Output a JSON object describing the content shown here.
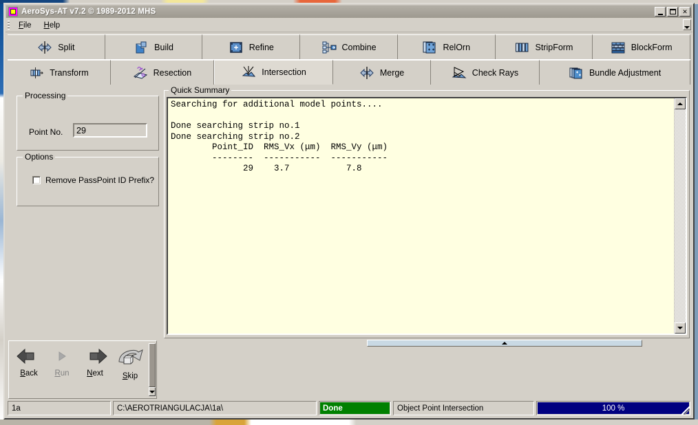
{
  "window": {
    "title": "AeroSys-AT  v7.2 © 1989-2012 MHS",
    "icon": "app-icon",
    "buttons": {
      "minimize": "_",
      "maximize": "□",
      "close": "✕"
    }
  },
  "menu": {
    "items": [
      {
        "label": "File",
        "accel": "F"
      },
      {
        "label": "Help",
        "accel": "H"
      }
    ],
    "overflow": "chevron-down-icon"
  },
  "toolbar": {
    "row1": [
      {
        "label": "Split",
        "icon": "split-icon",
        "selected": false
      },
      {
        "label": "Build",
        "icon": "build-icon",
        "selected": false
      },
      {
        "label": "Refine",
        "icon": "refine-icon",
        "selected": false
      },
      {
        "label": "Combine",
        "icon": "combine-icon",
        "selected": false
      },
      {
        "label": "RelOrn",
        "icon": "relorn-icon",
        "selected": false
      },
      {
        "label": "StripForm",
        "icon": "stripform-icon",
        "selected": false
      },
      {
        "label": "BlockForm",
        "icon": "blockform-icon",
        "selected": false
      }
    ],
    "row2": [
      {
        "label": "Transform",
        "icon": "transform-icon",
        "selected": false
      },
      {
        "label": "Resection",
        "icon": "resection-icon",
        "selected": false
      },
      {
        "label": "Intersection",
        "icon": "intersection-icon",
        "selected": true
      },
      {
        "label": "Merge",
        "icon": "merge-icon",
        "selected": false
      },
      {
        "label": "Check Rays",
        "icon": "check-rays-icon",
        "selected": false
      },
      {
        "label": "Bundle Adjustment",
        "icon": "bundle-adjustment-icon",
        "selected": false
      }
    ]
  },
  "processing": {
    "group_title": "Processing",
    "point_no_label": "Point  No.",
    "point_no_value": "29",
    "point_no_placeholder": ""
  },
  "options": {
    "group_title": "Options",
    "remove_prefix_label": "Remove PassPoint ID Prefix?",
    "remove_prefix_checked": false
  },
  "summary": {
    "group_title": "Quick Summary",
    "text": "Searching for additional model points....\n\nDone searching strip no.1\nDone searching strip no.2\n        Point_ID  RMS_Vx (μm)  RMS_Vy (μm)\n        --------  -----------  -----------\n              29    3.7           7.8",
    "scroll_up": "triangle-up-icon",
    "scroll_down": "triangle-down-icon"
  },
  "splitter": {
    "handle": "chevron-up-icon"
  },
  "nav": {
    "buttons": [
      {
        "label": "Back",
        "accel": "B",
        "icon": "arrow-left-icon",
        "enabled": true
      },
      {
        "label": "Run",
        "accel": "R",
        "icon": "play-icon",
        "enabled": false
      },
      {
        "label": "Next",
        "accel": "N",
        "icon": "arrow-right-icon",
        "enabled": true
      },
      {
        "label": "Skip",
        "accel": "S",
        "icon": "skip-arrow-icon",
        "enabled": true
      }
    ]
  },
  "status": {
    "project": "1a",
    "path": "C:\\AEROTRIANGULACJA\\1a\\",
    "state": "Done",
    "state_color": "#008000",
    "task": "Object Point Intersection",
    "progress_text": "100 %",
    "progress_percent": 100,
    "progress_color": "#000080"
  }
}
